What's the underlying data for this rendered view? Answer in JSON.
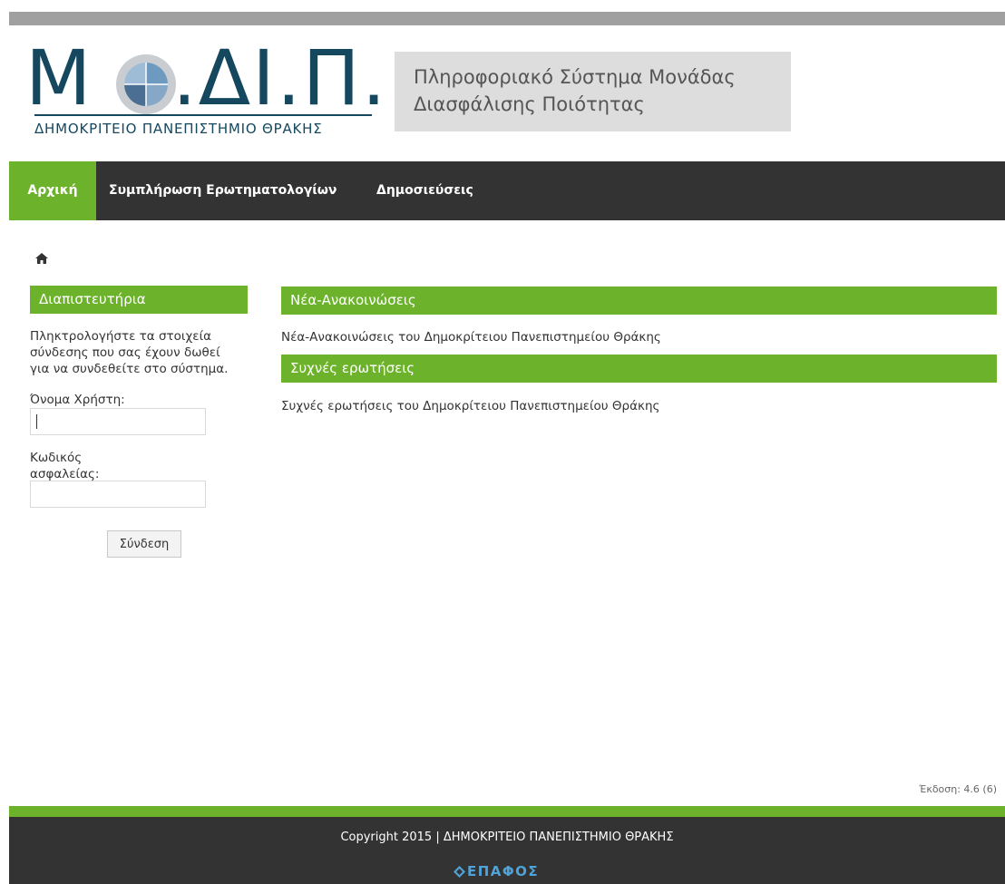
{
  "logo": {
    "letter_m": "Μ",
    "letters_rest": ".ΔΙ.Π.",
    "subtitle": "ΔΗΜΟΚΡΙΤΕΙΟ ΠΑΝΕΠΙΣΤΗΜΙΟ ΘΡΑΚΗΣ"
  },
  "header": {
    "system_title": "Πληροφοριακό Σύστημα Μονάδας Διασφάλισης Ποιότητας"
  },
  "nav": {
    "items": [
      {
        "label": "Αρχική",
        "active": true
      },
      {
        "label": "Συμπλήρωση Ερωτηματολογίων",
        "active": false
      },
      {
        "label": "Δημοσιεύσεις",
        "active": false
      }
    ]
  },
  "login": {
    "title": "Διαπιστευτήρια",
    "description": "Πληκτρολογήστε τα στοιχεία σύνδεσης που σας έχουν δωθεί για να συνδεθείτε στο σύστημα.",
    "username_label": "Όνομα Χρήστη:",
    "username_value": "",
    "password_label": "Κωδικός ασφαλείας:",
    "password_value": "",
    "submit_label": "Σύνδεση"
  },
  "news": {
    "title": "Νέα-Ανακοινώσεις",
    "text": "Νέα-Ανακοινώσεις του Δημοκρίτειου Πανεπιστημείου Θράκης"
  },
  "faq": {
    "title": "Συχνές ερωτήσεις",
    "text": "Συχνές ερωτήσεις του Δημοκρίτειου Πανεπιστημείου Θράκης"
  },
  "version": "Έκδοση: 4.6 (6)",
  "footer": {
    "copyright": "Copyright 2015 | ΔΗΜΟΚΡΙΤΕΙΟ ΠΑΝΕΠΙΣΤΗΜΙΟ ΘΡΑΚΗΣ",
    "brand": "ΕΠΑΦΟΣ"
  },
  "colors": {
    "accent_green": "#6cb32b",
    "nav_dark": "#333333",
    "logo_blue": "#15485f",
    "brand_blue": "#4fa3d9"
  },
  "icons": {
    "breadcrumb": "home-icon",
    "logo": "globe-icon",
    "footer_brand": "epafos-logo-icon"
  }
}
